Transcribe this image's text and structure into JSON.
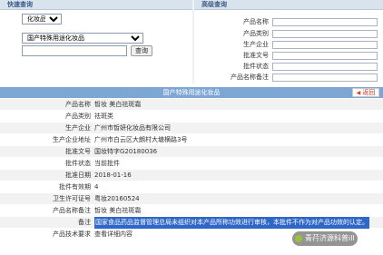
{
  "quick_search": {
    "title": "快速查询",
    "type_value": "化妆品",
    "database_value": "国产特殊用途化妆品",
    "query_button": "查询"
  },
  "advanced_search": {
    "title": "高级查询",
    "fields": [
      {
        "label": "产品名称"
      },
      {
        "label": "产品类别"
      },
      {
        "label": "生产企业"
      },
      {
        "label": "批准文号"
      },
      {
        "label": "批件状态"
      },
      {
        "label": "产品名称备注"
      }
    ],
    "query_button": "查询"
  },
  "detail": {
    "section_title": "国产特殊用途化妆品",
    "back_button": "返回",
    "rows": [
      {
        "label": "产品名称",
        "value": "皙妆 美白祛斑霜"
      },
      {
        "label": "产品类别",
        "value": "祛斑类"
      },
      {
        "label": "生产企业",
        "value": "广州市皙妍化妆品有限公司"
      },
      {
        "label": "生产企业地址",
        "value": "广州市白云区大朗村大塘横路3号"
      },
      {
        "label": "批准文号",
        "value": "国妆特字G20180036"
      },
      {
        "label": "批件状态",
        "value": "当前批件"
      },
      {
        "label": "批准日期",
        "value": "2018-01-16"
      },
      {
        "label": "批件有效期",
        "value": "4"
      },
      {
        "label": "卫生许可证号",
        "value": "粤妆20160524"
      },
      {
        "label": "产品名称备注",
        "value": "皙妆 美白祛斑霜"
      },
      {
        "label": "备注",
        "value": "国家食品药品监督管理总局未组织对本产品所称功效进行审核，本批件不作为对产品功效的认定。"
      },
      {
        "label": "产品技术要求",
        "value": "查看详细内容"
      }
    ]
  },
  "watermark": {
    "text": "青荇济源科普ill"
  }
}
